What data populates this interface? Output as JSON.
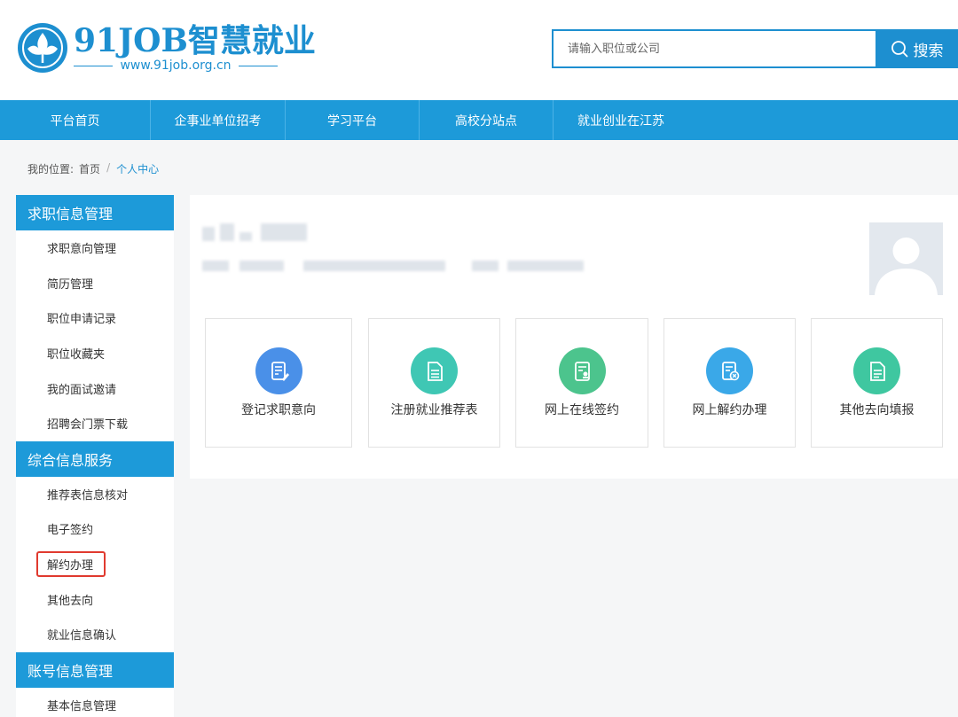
{
  "header": {
    "logo_main": "91JOB智慧就业",
    "logo_url": "www.91job.org.cn",
    "search_placeholder": "请输入职位或公司",
    "search_button": "搜索",
    "colors": {
      "brand": "#1d8fd0",
      "nav": "#1d9ad9"
    }
  },
  "nav": {
    "items": [
      {
        "label": "平台首页"
      },
      {
        "label": "企事业单位招考"
      },
      {
        "label": "学习平台"
      },
      {
        "label": "高校分站点"
      },
      {
        "label": "就业创业在江苏"
      }
    ]
  },
  "breadcrumb": {
    "prefix": "我的位置:",
    "home": "首页",
    "separator": "/",
    "current": "个人中心"
  },
  "sidebar": {
    "sections": [
      {
        "title": "求职信息管理",
        "items": [
          "求职意向管理",
          "简历管理",
          "职位申请记录",
          "职位收藏夹",
          "我的面试邀请",
          "招聘会门票下载"
        ]
      },
      {
        "title": "综合信息服务",
        "items": [
          "推荐表信息核对",
          "电子签约",
          "解约办理",
          "其他去向",
          "就业信息确认"
        ]
      },
      {
        "title": "账号信息管理",
        "items": [
          "基本信息管理"
        ]
      }
    ],
    "highlighted_item": "解约办理"
  },
  "cards": [
    {
      "label": "登记求职意向",
      "icon": "edit-document-icon",
      "color": "#4a90e8"
    },
    {
      "label": "注册就业推荐表",
      "icon": "document-icon",
      "color": "#3fc7b4"
    },
    {
      "label": "网上在线签约",
      "icon": "sign-document-icon",
      "color": "#4cc48d"
    },
    {
      "label": "网上解约办理",
      "icon": "cancel-document-icon",
      "color": "#3aa8e8"
    },
    {
      "label": "其他去向填报",
      "icon": "document-icon",
      "color": "#3fc7a0"
    }
  ]
}
